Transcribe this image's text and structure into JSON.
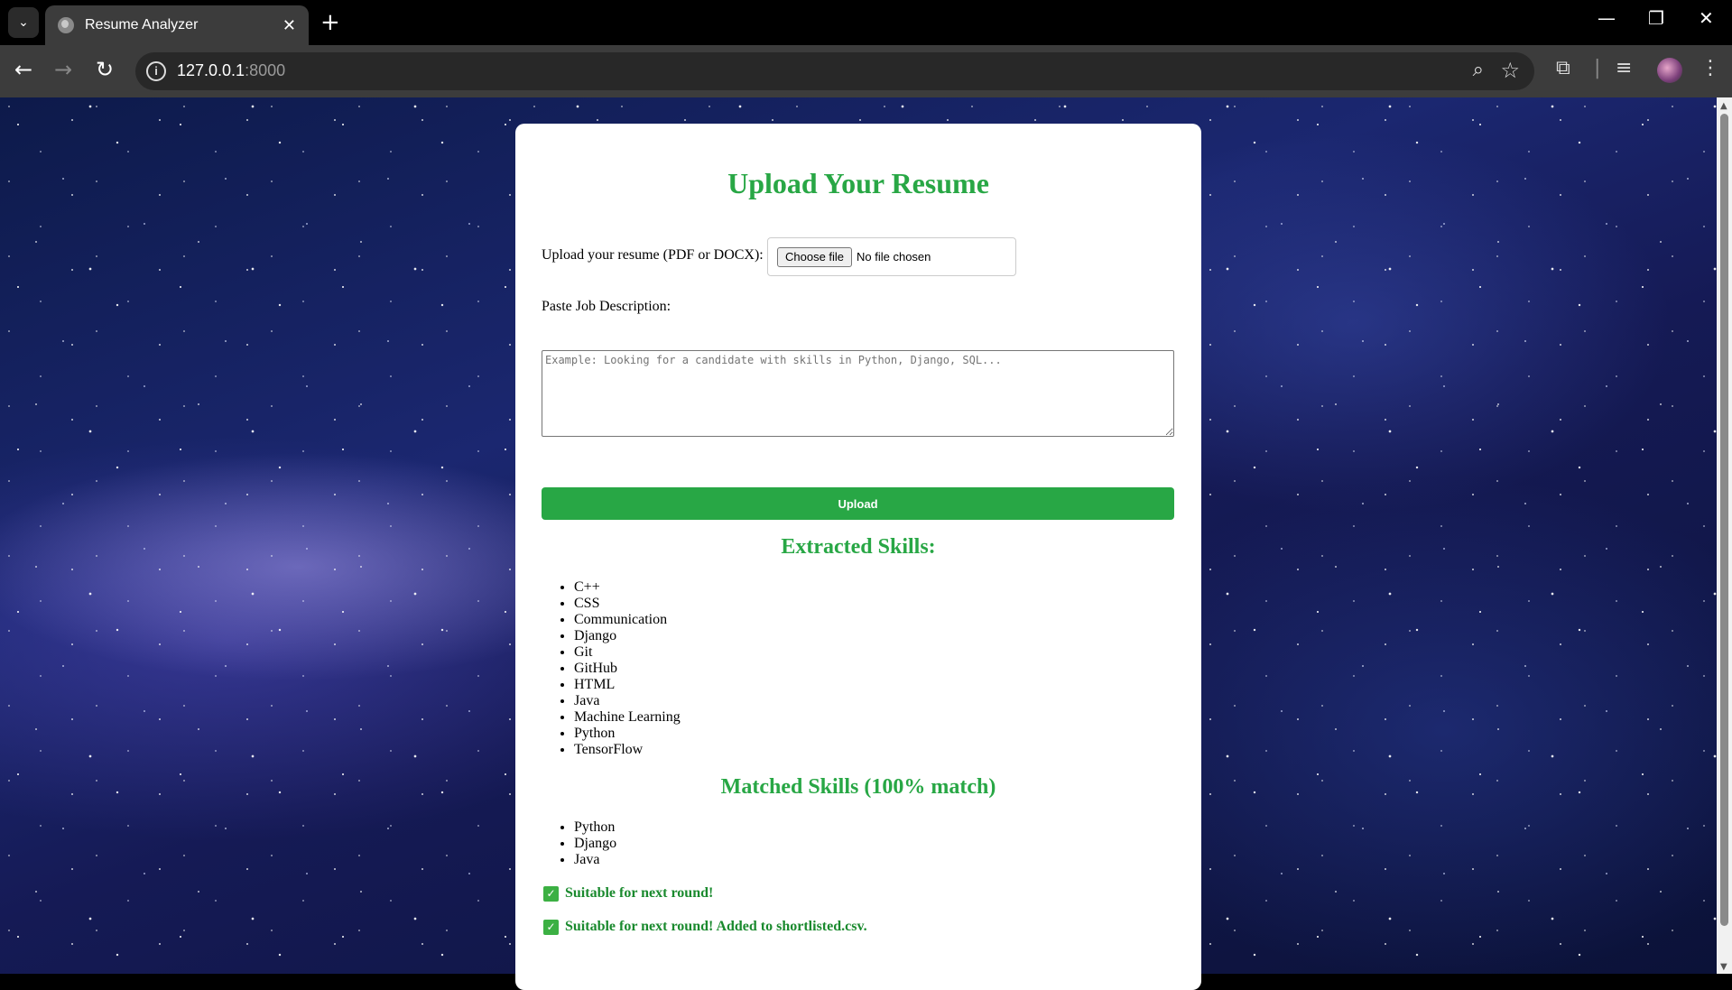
{
  "browser": {
    "tab_title": "Resume Analyzer",
    "url_host": "127.0.0.1",
    "url_port": ":8000"
  },
  "page": {
    "title": "Upload Your Resume",
    "file_label": "Upload your resume (PDF or DOCX):",
    "choose_file": "Choose file",
    "no_file": "No file chosen",
    "jd_label": "Paste Job Description:",
    "jd_placeholder": "Example: Looking for a candidate with skills in Python, Django, SQL...",
    "upload_label": "Upload",
    "extracted_title": "Extracted Skills:",
    "extracted_skills": [
      "C++",
      "CSS",
      "Communication",
      "Django",
      "Git",
      "GitHub",
      "HTML",
      "Java",
      "Machine Learning",
      "Python",
      "TensorFlow"
    ],
    "matched_title": "Matched Skills (100% match)",
    "matched_skills": [
      "Python",
      "Django",
      "Java"
    ],
    "status_1": "Suitable for next round!",
    "status_2": "Suitable for next round! Added to shortlisted.csv."
  },
  "colors": {
    "accent": "#28a745"
  }
}
